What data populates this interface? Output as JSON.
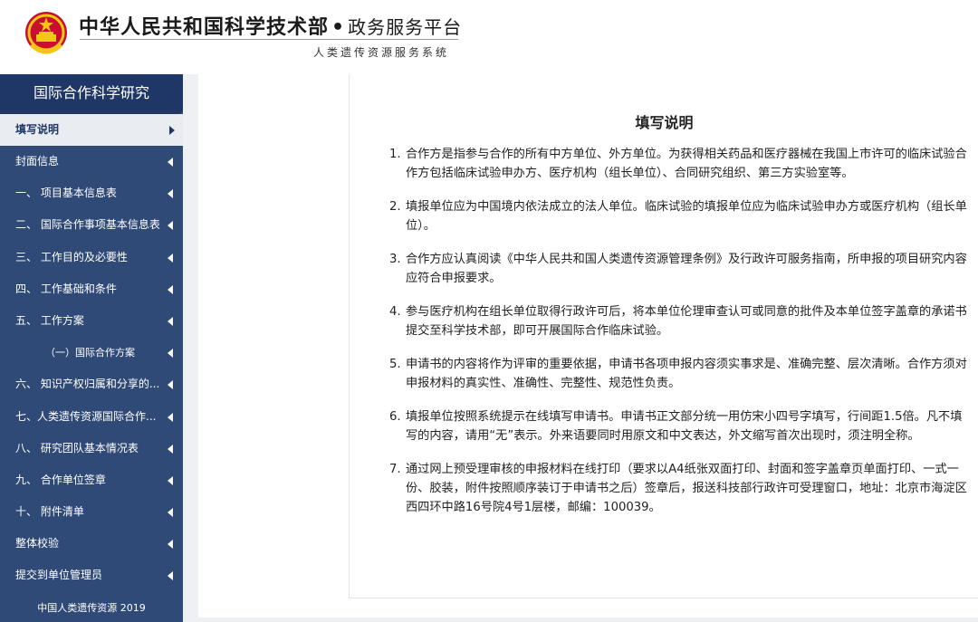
{
  "header": {
    "title": "中华人民共和国科学技术部",
    "separator": "•",
    "platform": "政务服务平台",
    "subtitle": "人类遗传资源服务系统"
  },
  "sidebar": {
    "heading": "国际合作科学研究",
    "active": "填写说明",
    "items": [
      {
        "label": "封面信息"
      },
      {
        "label": "一、 项目基本信息表"
      },
      {
        "label": "二、 国际合作事项基本信息表"
      },
      {
        "label": "三、 工作目的及必要性"
      },
      {
        "label": "四、 工作基础和条件"
      },
      {
        "label": "五、 工作方案"
      },
      {
        "label": "（一）国际合作方案"
      },
      {
        "label": "六、 知识产权归属和分享的..."
      },
      {
        "label": "七、人类遗传资源国际合作..."
      },
      {
        "label": "八、 研究团队基本情况表"
      },
      {
        "label": "九、 合作单位签章"
      },
      {
        "label": "十、 附件清单"
      },
      {
        "label": "整体校验"
      },
      {
        "label": "提交到单位管理员"
      }
    ],
    "footer": "中国人类遗传资源 2019"
  },
  "doc": {
    "title": "填写说明",
    "items": [
      {
        "num": "1.",
        "text": "合作方是指参与合作的所有中方单位、外方单位。为获得相关药品和医疗器械在我国上市许可的临床试验合作方包括临床试验申办方、医疗机构（组长单位）、合同研究组织、第三方实验室等。"
      },
      {
        "num": "2.",
        "text": "填报单位应为中国境内依法成立的法人单位。临床试验的填报单位应为临床试验申办方或医疗机构（组长单位）。"
      },
      {
        "num": "3.",
        "text": "合作方应认真阅读《中华人民共和国人类遗传资源管理条例》及行政许可服务指南，所申报的项目研究内容应符合申报要求。"
      },
      {
        "num": "4.",
        "text": "参与医疗机构在组长单位取得行政许可后，将本单位伦理审查认可或同意的批件及本单位签字盖章的承诺书提交至科学技术部，即可开展国际合作临床试验。"
      },
      {
        "num": "5.",
        "text": "申请书的内容将作为评审的重要依据，申请书各项申报内容须实事求是、准确完整、层次清晰。合作方须对申报材料的真实性、准确性、完整性、规范性负责。"
      },
      {
        "num": "6.",
        "text": "填报单位按照系统提示在线填写申请书。申请书正文部分统一用仿宋小四号字填写，行间距1.5倍。凡不填写的内容，请用“无”表示。外来语要同时用原文和中文表达，外文缩写首次出现时，须注明全称。"
      },
      {
        "num": "7.",
        "text": "通过网上预受理审核的申报材料在线打印（要求以A4纸张双面打印、封面和签字盖章页单面打印、一式一份、胶装，附件按照顺序装订于申请书之后）签章后，报送科技部行政许可受理窗口，地址：北京市海淀区西四环中路16号院4号1层楼，邮编：100039。"
      }
    ]
  }
}
